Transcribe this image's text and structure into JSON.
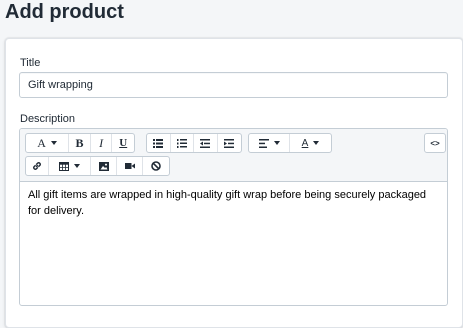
{
  "page": {
    "title": "Add product"
  },
  "form": {
    "title_label": "Title",
    "title_value": "Gift wrapping",
    "description_label": "Description",
    "description_text": "All gift items are wrapped in high-quality gift wrap before being securely packaged for delivery."
  },
  "toolbar": {
    "font_label": "A",
    "bold_label": "B",
    "italic_label": "I",
    "underline_label": "U",
    "text_color_label": "A",
    "code_view_label": "<>"
  }
}
